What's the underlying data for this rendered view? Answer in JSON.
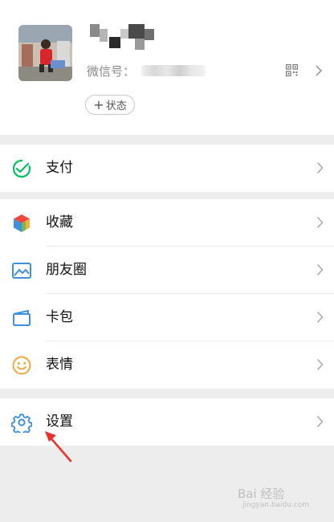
{
  "profile": {
    "wechat_id_label": "微信号：",
    "status_button_label": "状态"
  },
  "menu": {
    "pay": "支付",
    "favorites": "收藏",
    "moments": "朋友圈",
    "cards": "卡包",
    "stickers": "表情",
    "settings": "设置"
  },
  "watermark": {
    "brand": "Bai 经验",
    "url": "jingyan.baidu.com"
  },
  "colors": {
    "pay_green": "#07c160",
    "moments_blue": "#3d8fe0",
    "stickers_orange": "#f4a73c",
    "settings_blue": "#3d8fe0",
    "annotation_arrow": "#e8332e"
  },
  "icons": {
    "pay": "pay-icon",
    "favorites": "favorites-cube-icon",
    "moments": "moments-image-icon",
    "cards": "card-wallet-icon",
    "stickers": "smiley-icon",
    "settings": "gear-icon"
  }
}
